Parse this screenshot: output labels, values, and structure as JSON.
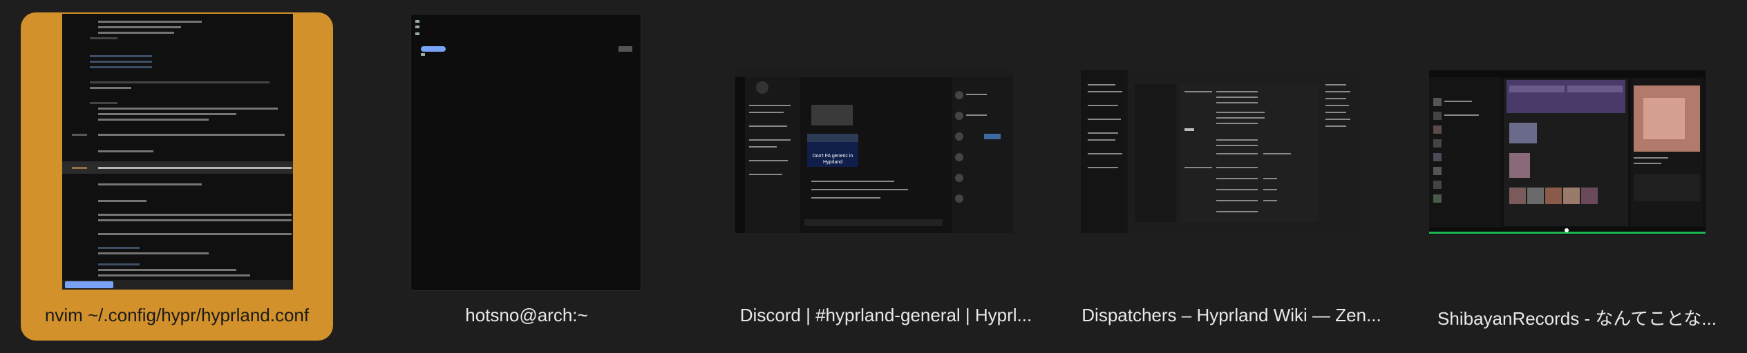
{
  "switcher": {
    "windows": [
      {
        "title": "nvim ~/.config/hypr/hyprland.conf",
        "selected": true,
        "accent": "#d2912b"
      },
      {
        "title": "hotsno@arch:~",
        "selected": false
      },
      {
        "title": "Discord | #hyprland-general | Hyprl...",
        "selected": false
      },
      {
        "title": "Dispatchers – Hyprland Wiki — Zen...",
        "selected": false
      },
      {
        "title": "ShibayanRecords - なんてことな...",
        "selected": false
      }
    ]
  },
  "discord_preview": {
    "banner_text": "Don't FA generic in Hyprland"
  }
}
